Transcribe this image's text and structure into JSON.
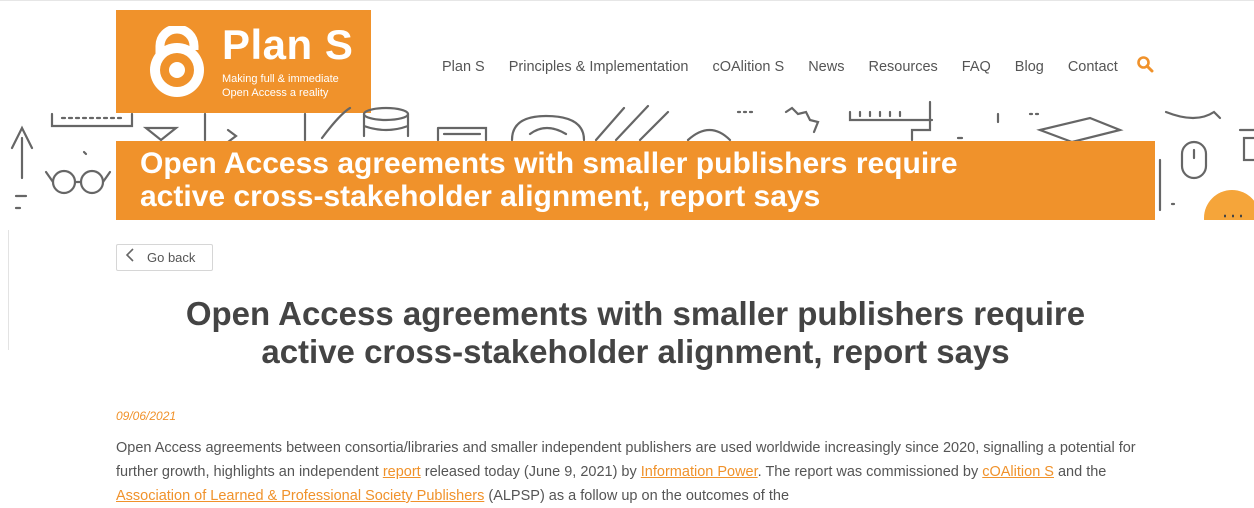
{
  "logo": {
    "title": "Plan S",
    "tagline_line1": "Making full & immediate",
    "tagline_line2": "Open Access a reality"
  },
  "nav": {
    "items": [
      "Plan S",
      "Principles & Implementation",
      "cOAlition S",
      "News",
      "Resources",
      "FAQ",
      "Blog",
      "Contact"
    ],
    "search_icon": "search-icon"
  },
  "hero": {
    "title_line1": "Open Access agreements with smaller publishers require",
    "title_line2": "active cross-stakeholder alignment, report says"
  },
  "go_back": {
    "label": "Go back"
  },
  "article": {
    "headline_line1": "Open Access agreements with smaller publishers require",
    "headline_line2": "active cross-stakeholder alignment, report says",
    "date": "09/06/2021",
    "p1_a": "Open Access agreements between consortia/libraries and smaller independent publishers are used worldwide increasingly since 2020, signalling a potential for further growth, highlights an independent ",
    "link_report": "report",
    "p1_b": " released today (June 9, 2021) by ",
    "link_information_power": "Information Power",
    "p1_c": ". The report was commissioned by ",
    "link_coalition_s": "cOAlition S",
    "p1_d": " and the ",
    "link_alpsp": "Association of Learned & Professional Society Publishers",
    "p1_e": " (ALPSP) as a follow up on the outcomes of the"
  },
  "colors": {
    "accent": "#f0922b",
    "text": "#444444"
  }
}
